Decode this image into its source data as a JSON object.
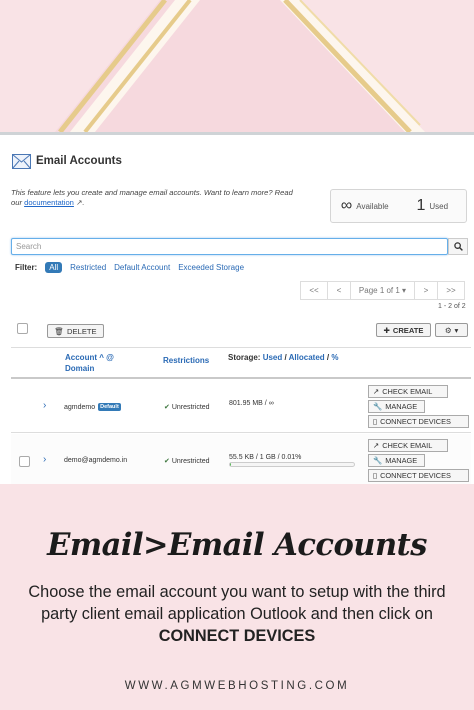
{
  "panel": {
    "title": "Email Accounts",
    "intro_text": "This feature lets you create and manage email accounts. Want to learn more? Read our ",
    "doc_link": "documentation",
    "stats": {
      "available_value": "∞",
      "available_label": "Available",
      "used_value": "1",
      "used_label": "Used"
    },
    "search_placeholder": "Search",
    "filter": {
      "label": "Filter:",
      "options": [
        "All",
        "Restricted",
        "Default Account",
        "Exceeded Storage"
      ],
      "active": "All"
    },
    "pagination": {
      "first": "<<",
      "prev": "<",
      "page": "Page 1 of 1 ▾",
      "next": ">",
      "last": ">>",
      "count": "1 - 2 of 2"
    },
    "toolbar": {
      "delete_label": "DELETE",
      "create_label": "CREATE"
    },
    "table": {
      "account_header": "Account ^ @",
      "domain_header": "Domain",
      "restrictions_header": "Restrictions",
      "storage_label": "Storage:",
      "used_label": "Used",
      "allocated_label": "Allocated",
      "percent_label": "%",
      "rows": [
        {
          "email": "agmdemo",
          "badge": "Default",
          "restriction": "Unrestricted",
          "usage": "801.95 MB / ∞",
          "usage_fraction": 0
        },
        {
          "email": "demo@agmdemo.in",
          "restriction": "Unrestricted",
          "usage": "55.5 KB / 1 GB / 0.01%",
          "usage_fraction": 0.0001
        }
      ]
    },
    "actions": {
      "check_email": "CHECK EMAIL",
      "manage": "MANAGE",
      "connect_devices": "CONNECT DEVICES"
    }
  },
  "heading": "Email>Email Accounts",
  "description": {
    "text": "Choose the email account you want to setup with the third party client email application Outlook and then click on ",
    "emphasis": "CONNECT DEVICES"
  },
  "site": "WWW.AGMWEBHOSTING.COM",
  "colors": {
    "background": "#f9e3e6",
    "banner_stripe": "#e6cb8b",
    "link_blue": "#2a6ab5",
    "badge_blue": "#337ab7",
    "success_green": "#3c763d"
  }
}
